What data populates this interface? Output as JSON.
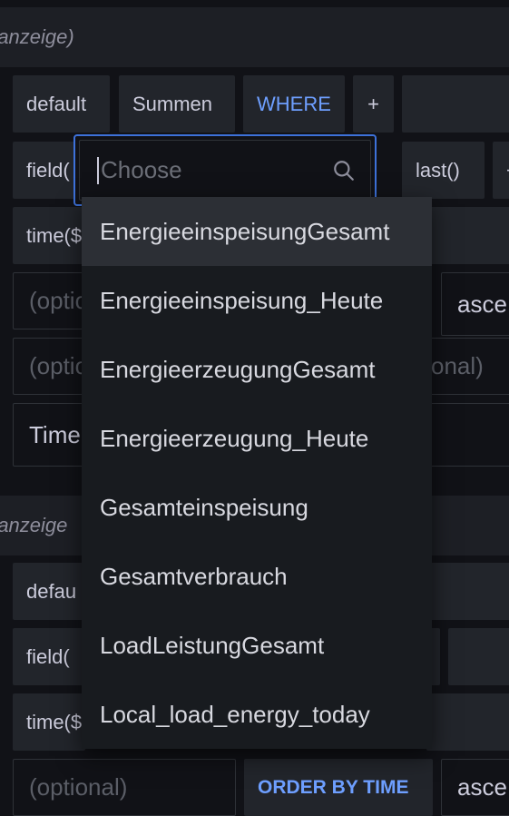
{
  "query_a": {
    "alias_placeholder": "ranzeige)",
    "from_row": {
      "default_label": "default",
      "measurement_label": "Summen",
      "where_label": "WHERE",
      "add_label": "+"
    },
    "select_row": {
      "field_label": "field(",
      "fn_label": "last()",
      "extra_label": "+"
    },
    "group_row": {
      "time_label": "time($"
    },
    "tz_row": {
      "tz_placeholder": "(optio",
      "order_label": "asce"
    },
    "limit_row": {
      "limit_placeholder": "(optio",
      "slimit_placeholder": "onal)"
    },
    "format_row": {
      "format_value": "Time"
    }
  },
  "query_b": {
    "alias_placeholder": "ranzeige",
    "from_row": {
      "default_label": "defau"
    },
    "select_row": {
      "field_label": "field("
    },
    "group_row": {
      "time_label": "time($"
    },
    "tz_row": {
      "tz_placeholder": "(optional)",
      "order_label": "ORDER BY TIME",
      "order_value": "asce"
    }
  },
  "field_picker": {
    "search_placeholder": "Choose",
    "options": [
      "EnergieeinspeisungGesamt",
      "Energieeinspeisung_Heute",
      "EnergieerzeugungGesamt",
      "Energieerzeugung_Heute",
      "Gesamteinspeisung",
      "Gesamtverbrauch",
      "LoadLeistungGesamt",
      "Local_load_energy_today"
    ],
    "highlighted_index": 0
  },
  "colors": {
    "accent": "#3d71d9",
    "keyword": "#6e9fff",
    "background": "#111217",
    "segment": "#22252b"
  }
}
